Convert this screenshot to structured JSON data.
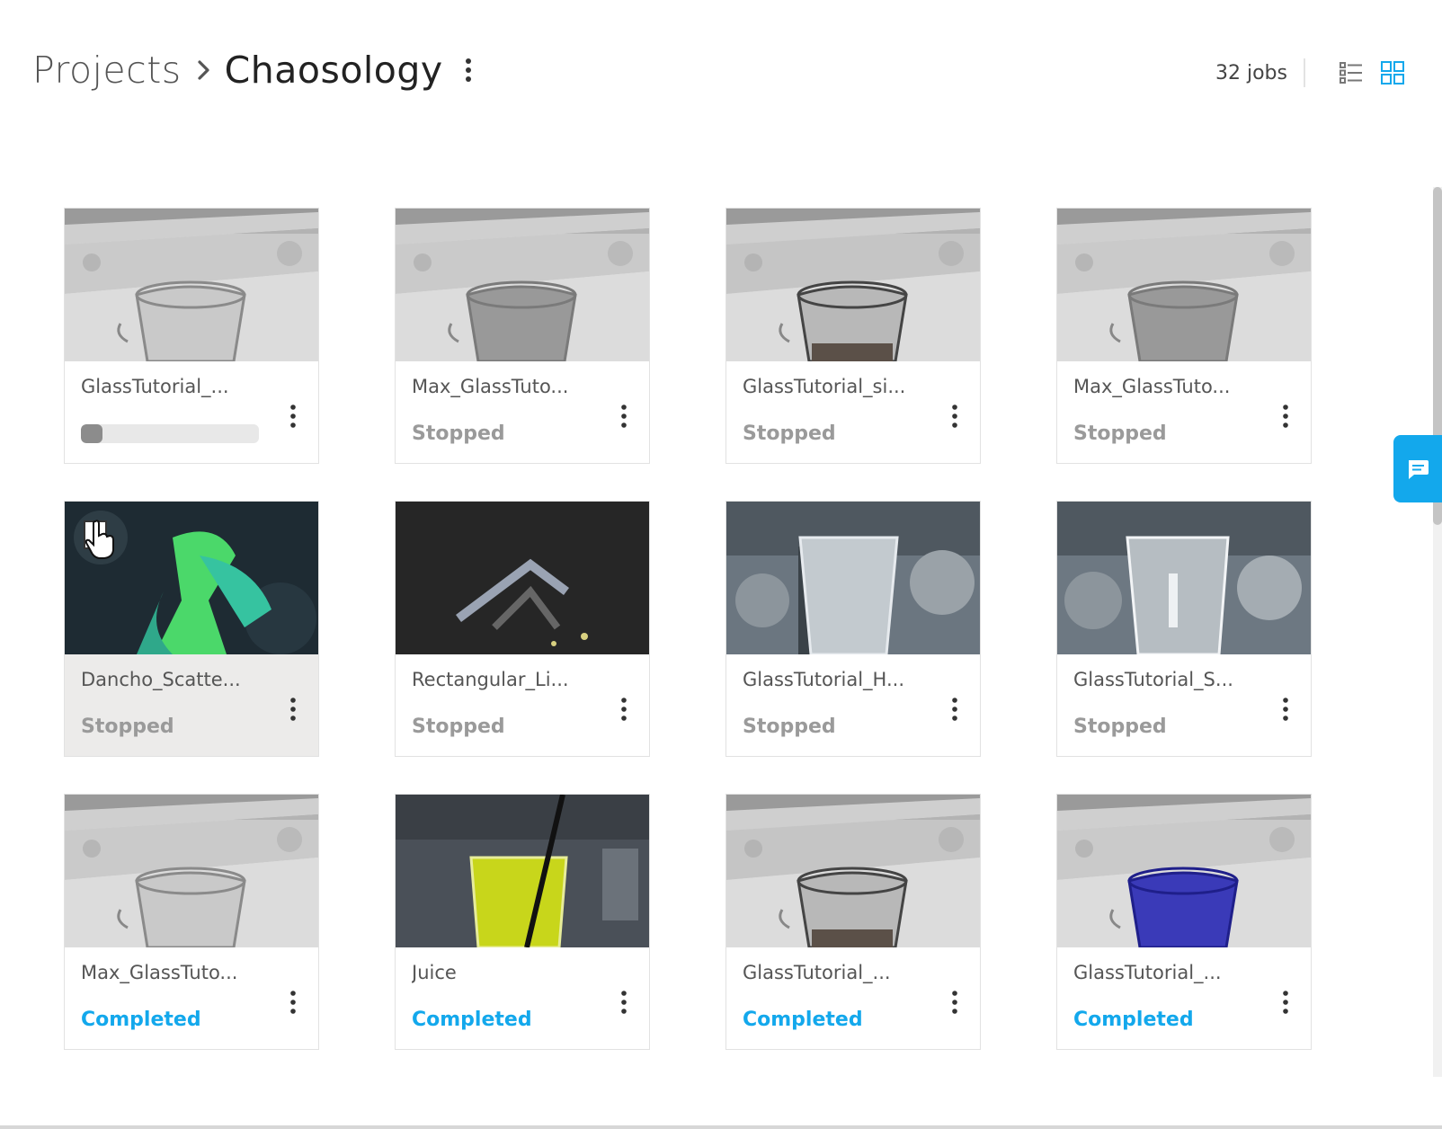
{
  "breadcrumb": {
    "root": "Projects",
    "current": "Chaosology"
  },
  "header": {
    "jobs_count": "32 jobs",
    "active_view": "grid"
  },
  "icons": {
    "chevron": "chevron-right-icon",
    "title_menu": "more-vertical-icon",
    "list_view": "list-view-icon",
    "grid_view": "grid-view-icon",
    "chat": "chat-icon"
  },
  "colors": {
    "accent": "#13a8ec",
    "stopped": "#9a9a9a",
    "progress_fill": "#8c8c8c"
  },
  "jobs": [
    {
      "name": "GlassTutorial_...",
      "status": "",
      "progress": 0.12,
      "thumb": "clear-glass-kitchen"
    },
    {
      "name": "Max_GlassTuto...",
      "status": "Stopped",
      "thumb": "grey-glass-kitchen"
    },
    {
      "name": "GlassTutorial_si...",
      "status": "Stopped",
      "thumb": "clear-glass-kitchen-dark"
    },
    {
      "name": "Max_GlassTuto...",
      "status": "Stopped",
      "thumb": "grey-glass-kitchen"
    },
    {
      "name": "Dancho_Scatte...",
      "status": "Stopped",
      "thumb": "green-plant-dark"
    },
    {
      "name": "Rectangular_Li...",
      "status": "Stopped",
      "thumb": "dark-light-rig"
    },
    {
      "name": "GlassTutorial_H...",
      "status": "Stopped",
      "thumb": "tall-glass-blurred"
    },
    {
      "name": "GlassTutorial_S...",
      "status": "Stopped",
      "thumb": "tall-clear-glass-blurred"
    },
    {
      "name": "Max_GlassTuto...",
      "status": "Completed",
      "thumb": "clear-glass-kitchen"
    },
    {
      "name": "Juice",
      "status": "Completed",
      "thumb": "juice-glass"
    },
    {
      "name": "GlassTutorial_...",
      "status": "Completed",
      "thumb": "clear-glass-kitchen-dark"
    },
    {
      "name": "GlassTutorial_...",
      "status": "Completed",
      "thumb": "blue-glass-kitchen"
    }
  ]
}
